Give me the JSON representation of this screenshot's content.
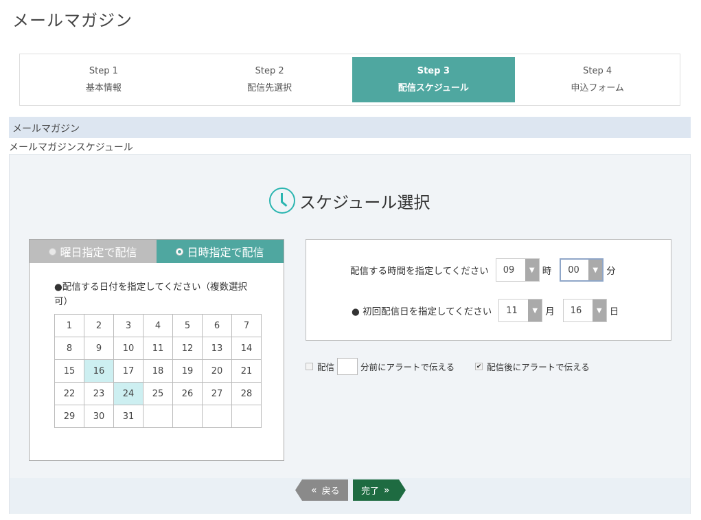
{
  "page": {
    "title": "メールマガジン"
  },
  "stepper": {
    "steps": [
      {
        "num": "Step 1",
        "label": "基本情報"
      },
      {
        "num": "Step 2",
        "label": "配信先選択"
      },
      {
        "num": "Step 3",
        "label": "配信スケジュール"
      },
      {
        "num": "Step 4",
        "label": "申込フォーム"
      }
    ],
    "active_index": 2
  },
  "section": {
    "bar": "メールマガジン",
    "sub": "メールマガジンスケジュール"
  },
  "schedule": {
    "title": "スケジュール選択",
    "tabs": [
      {
        "label": "曜日指定で配信"
      },
      {
        "label": "日時指定で配信"
      }
    ],
    "selected_tab": 1,
    "calendar_desc": "●配信する日付を指定してください（複数選択可）",
    "calendar": {
      "rows": [
        [
          "1",
          "2",
          "3",
          "4",
          "5",
          "6",
          "7"
        ],
        [
          "8",
          "9",
          "10",
          "11",
          "12",
          "13",
          "14"
        ],
        [
          "15",
          "16",
          "17",
          "18",
          "19",
          "20",
          "21"
        ],
        [
          "22",
          "23",
          "24",
          "25",
          "26",
          "27",
          "28"
        ],
        [
          "29",
          "30",
          "31",
          "",
          "",
          "",
          ""
        ]
      ],
      "selected_days": [
        "16",
        "24"
      ]
    },
    "time": {
      "label": "配信する時間を指定してください",
      "hour": "09",
      "hour_unit": "時",
      "minute": "00",
      "minute_unit": "分"
    },
    "first_date": {
      "label": "● 初回配信日を指定してください",
      "month": "11",
      "month_unit": "月",
      "day": "16",
      "day_unit": "日"
    },
    "alerts": {
      "before_prefix": "配信",
      "before_value": "",
      "before_suffix": "分前にアラートで伝える",
      "before_checked": false,
      "after_label": "配信後にアラートで伝える",
      "after_checked": true
    }
  },
  "buttons": {
    "back": "戻る",
    "done": "完了"
  },
  "colors": {
    "accent": "#4fa7a0",
    "done": "#1e6b41",
    "back": "#8a8a8a",
    "clock": "#2bb5b0"
  },
  "icons": {
    "title": "clock-icon",
    "back": "double-chevron-left-icon",
    "done": "double-chevron-right-icon",
    "select": "caret-down-icon"
  }
}
